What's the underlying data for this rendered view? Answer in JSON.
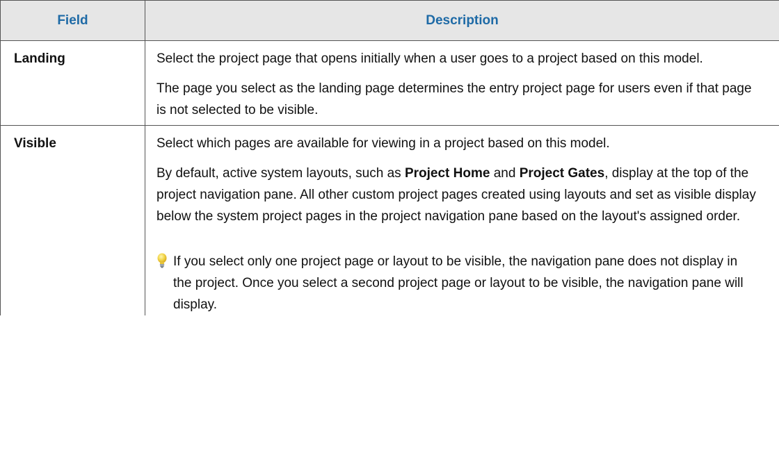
{
  "table": {
    "headers": {
      "field": "Field",
      "description": "Description"
    },
    "rows": [
      {
        "field": "Landing",
        "paragraphs": [
          "Select the project page that opens initially when a user goes to a project based on this model.",
          "The page you select as the landing page determines the entry project page for users even if that page is not selected to be visible."
        ]
      },
      {
        "field": "Visible",
        "paragraphs": [
          "Select which pages are available for viewing in a project based on this model."
        ],
        "default_paragraph": {
          "part1": "By default, active system layouts, such as ",
          "bold1": "Project Home",
          "part2": " and ",
          "bold2": "Project Gates",
          "part3": ", display at the top of the project navigation pane. All other custom project pages created using layouts and set as visible display below the system project pages in the project navigation pane based on the layout's assigned order."
        },
        "tip": {
          "icon": "lightbulb-icon",
          "text": "If you select only one project page or layout to be visible, the navigation pane does not display in the project. Once you select a second project page or layout to be visible, the navigation pane will display."
        }
      }
    ]
  },
  "colors": {
    "header_text": "#1e6aa6",
    "header_background": "#e6e6e6",
    "border": "#555555",
    "tip_bulb": "#f2d64b"
  }
}
